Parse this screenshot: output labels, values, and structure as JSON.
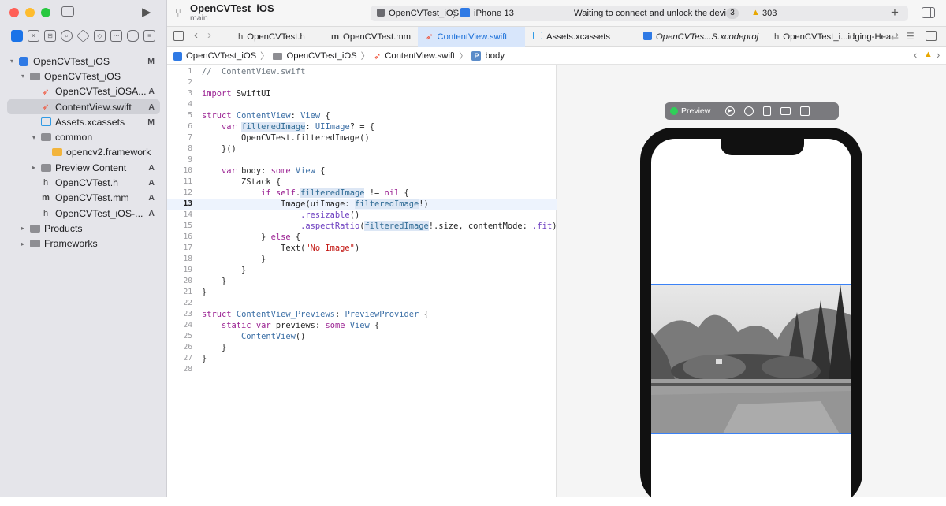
{
  "project": {
    "title": "OpenCVTest_iOS",
    "branch": "main"
  },
  "scheme": {
    "target": "OpenCVTest_iOS",
    "device": "iPhone 13",
    "status": "Waiting to connect and unlock the device",
    "status_count": "3",
    "warnings": "303"
  },
  "tree": [
    {
      "label": "OpenCVTest_iOS",
      "indent": 0,
      "disc": "▾",
      "icon": "app",
      "badge": "M"
    },
    {
      "label": "OpenCVTest_iOS",
      "indent": 1,
      "disc": "▾",
      "icon": "folder",
      "badge": ""
    },
    {
      "label": "OpenCVTest_iOSA...",
      "indent": 2,
      "disc": "",
      "icon": "swift",
      "badge": "A"
    },
    {
      "label": "ContentView.swift",
      "indent": 2,
      "disc": "",
      "icon": "swift",
      "badge": "A",
      "selected": true
    },
    {
      "label": "Assets.xcassets",
      "indent": 2,
      "disc": "",
      "icon": "assets",
      "badge": "M"
    },
    {
      "label": "common",
      "indent": 2,
      "disc": "▾",
      "icon": "folder",
      "badge": ""
    },
    {
      "label": "opencv2.framework",
      "indent": 3,
      "disc": "",
      "icon": "framework",
      "badge": ""
    },
    {
      "label": "Preview Content",
      "indent": 2,
      "disc": "▸",
      "icon": "folder",
      "badge": "A"
    },
    {
      "label": "OpenCVTest.h",
      "indent": 2,
      "disc": "",
      "icon": "h",
      "badge": "A"
    },
    {
      "label": "OpenCVTest.mm",
      "indent": 2,
      "disc": "",
      "icon": "m",
      "badge": "A"
    },
    {
      "label": "OpenCVTest_iOS-...",
      "indent": 2,
      "disc": "",
      "icon": "h",
      "badge": "A"
    },
    {
      "label": "Products",
      "indent": 1,
      "disc": "▸",
      "icon": "folder",
      "badge": ""
    },
    {
      "label": "Frameworks",
      "indent": 1,
      "disc": "▸",
      "icon": "folder",
      "badge": ""
    }
  ],
  "tabs": [
    {
      "label": "OpenCVTest.h",
      "icon": "h"
    },
    {
      "label": "OpenCVTest.mm",
      "icon": "m"
    },
    {
      "label": "ContentView.swift",
      "icon": "swift",
      "active": true
    },
    {
      "label": "Assets.xcassets",
      "icon": "assets"
    },
    {
      "label": "OpenCVTes...S.xcodeproj",
      "icon": "proj"
    },
    {
      "label": "OpenCVTest_i...idging-Hea",
      "icon": "h"
    }
  ],
  "jumpbar": [
    "OpenCVTest_iOS",
    "OpenCVTest_iOS",
    "ContentView.swift",
    "body"
  ],
  "current_line": "13",
  "code_lines": [
    "//  ContentView.swift",
    "",
    "import SwiftUI",
    "",
    "struct ContentView: View {",
    "    var filteredImage: UIImage? = {",
    "        OpenCVTest.filteredImage()",
    "    }()",
    "",
    "    var body: some View {",
    "        ZStack {",
    "            if self.filteredImage != nil {",
    "                Image(uiImage: filteredImage!)",
    "                    .resizable()",
    "                    .aspectRatio(filteredImage!.size, contentMode: .fit)",
    "            } else {",
    "                Text(\"No Image\")",
    "            }",
    "        }",
    "    }",
    "}",
    "",
    "struct ContentView_Previews: PreviewProvider {",
    "    static var previews: some View {",
    "        ContentView()",
    "    }",
    "}",
    ""
  ],
  "preview": {
    "label": "Preview"
  },
  "colors": {
    "accent": "#1a73e8",
    "sidebar": "#e5e5ea",
    "selection": "#cfd0d6"
  }
}
